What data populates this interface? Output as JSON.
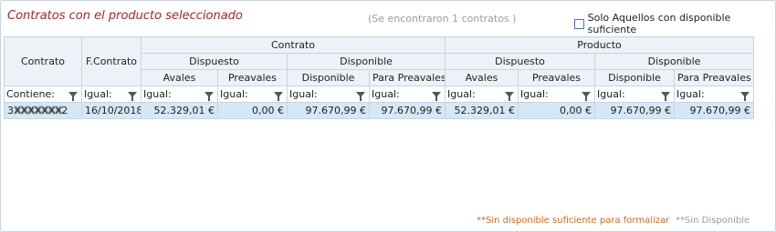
{
  "header": {
    "title": "Contratos con el producto seleccionado",
    "count": "(Se encontraron 1 contratos )",
    "checkbox_label": "Solo Aquellos con disponible suficiente",
    "checkbox_checked": false
  },
  "table": {
    "group_contrato": "Contrato",
    "group_producto": "Producto",
    "col_contrato": "Contrato",
    "col_fcontrato": "F.Contrato",
    "dispuesto": "Dispuesto",
    "disponible": "Disponible",
    "sub_avales": "Avales",
    "sub_preavales": "Preavales",
    "sub_disponible": "Disponible",
    "sub_para_preavales": "Para Preavales",
    "filters": [
      "Contiene:",
      "Igual:",
      "Igual:",
      "Igual:",
      "Igual:",
      "Igual:",
      "Igual:",
      "Igual:",
      "Igual:",
      "Igual:"
    ],
    "row": {
      "contrato_prefix": "3",
      "contrato_masked": "XXXXXXX",
      "contrato_suffix": "2",
      "fcontrato": "16/10/2018",
      "c_avales": "52.329,01 €",
      "c_preavales": "0,00 €",
      "c_disponible": "97.670,99 €",
      "c_para_preavales": "97.670,99 €",
      "p_avales": "52.329,01 €",
      "p_preavales": "0,00 €",
      "p_disponible": "97.670,99 €",
      "p_para_preavales": "97.670,99 €"
    }
  },
  "footer": {
    "note_insufficient": "**Sin disponible suficiente para formalizar",
    "note_unavailable": "**Sin Disponible"
  },
  "colors": {
    "title": "#a5262a",
    "header_bg": "#ecf2f8",
    "selected_row": "#d5e8f7",
    "note_orange": "#d06a1a"
  }
}
